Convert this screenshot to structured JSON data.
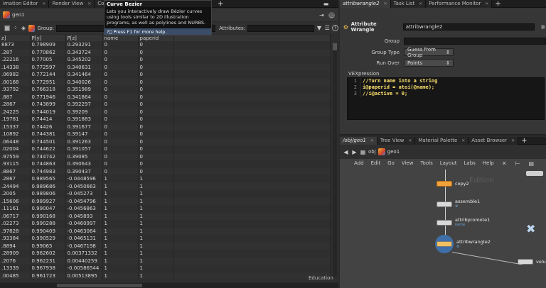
{
  "left_tabs": [
    {
      "label": "imation Editor"
    },
    {
      "label": "Render View"
    },
    {
      "label": "Composite Vi"
    }
  ],
  "right_tabs": [
    {
      "label": "attribwrangle2"
    },
    {
      "label": "Task List"
    },
    {
      "label": "Performance Monitor"
    }
  ],
  "path_left": "geo1",
  "path_right": {
    "obj": "obj",
    "geo": "geo1"
  },
  "filter": {
    "group_label": "Group:",
    "attributes_label": "Attributes:"
  },
  "tooltip": {
    "title": "Curve Bezier",
    "body": "Lets you interactively draw Bézier curves using tools similar to 2D illustration programs, as well as polylines and NURBS.",
    "help": "Press F1 for more help."
  },
  "spreadsheet": {
    "headers": [
      "z]",
      "P[y]",
      "P[z]",
      "name",
      "paperid"
    ],
    "rows": [
      [
        "8873",
        "0.798909",
        "0.293291",
        "0",
        "0"
      ],
      [
        ".287",
        "0.770862",
        "0.343724",
        "0",
        "0"
      ],
      [
        ".22216",
        "0.77005",
        "0.345202",
        "0",
        "0"
      ],
      [
        ".14338",
        "0.772597",
        "0.340631",
        "0",
        "0"
      ],
      [
        ".06982",
        "0.772144",
        "0.341464",
        "0",
        "0"
      ],
      [
        ".00168",
        "0.772951",
        "0.340026",
        "0",
        "0"
      ],
      [
        ".93792",
        "0.766318",
        "0.351989",
        "0",
        "0"
      ],
      [
        ".887",
        "0.771946",
        "0.341864",
        "0",
        "0"
      ],
      [
        ".2867",
        "0.743899",
        "0.392297",
        "0",
        "0"
      ],
      [
        ".24225",
        "0.744019",
        "0.39209",
        "0",
        "0"
      ],
      [
        ".19781",
        "0.74414",
        "0.391883",
        "0",
        "0"
      ],
      [
        ".15337",
        "0.74426",
        "0.391677",
        "0",
        "0"
      ],
      [
        ".10892",
        "0.744381",
        "0.39147",
        "0",
        "0"
      ],
      [
        ".06448",
        "0.744501",
        "0.391263",
        "0",
        "0"
      ],
      [
        ".02004",
        "0.744622",
        "0.391057",
        "0",
        "0"
      ],
      [
        ".97559",
        "0.744742",
        "0.39085",
        "0",
        "0"
      ],
      [
        ".93115",
        "0.744863",
        "0.390643",
        "0",
        "0"
      ],
      [
        ".8867",
        "0.744983",
        "0.390437",
        "0",
        "0"
      ],
      [
        ".2867",
        "0.989565",
        "-0.0448596",
        "1",
        "1"
      ],
      [
        ".24494",
        "0.989686",
        "-0.0450663",
        "1",
        "1"
      ],
      [
        ".2005",
        "0.989806",
        "-0.045273",
        "1",
        "1"
      ],
      [
        ".15606",
        "0.989927",
        "-0.0454796",
        "1",
        "1"
      ],
      [
        ".11161",
        "0.990047",
        "-0.0456863",
        "1",
        "1"
      ],
      [
        ".06717",
        "0.990168",
        "-0.045893",
        "1",
        "1"
      ],
      [
        ".02273",
        "0.990288",
        "-0.0460997",
        "1",
        "1"
      ],
      [
        ".97828",
        "0.990409",
        "-0.0463064",
        "1",
        "1"
      ],
      [
        ".93384",
        "0.990529",
        "-0.0465131",
        "1",
        "1"
      ],
      [
        ".8894",
        "0.99065",
        "-0.0467198",
        "1",
        "1"
      ],
      [
        ".28909",
        "0.962602",
        "0.00371332",
        "1",
        "1"
      ],
      [
        ".2076",
        "0.962231",
        "0.00440259",
        "1",
        "1"
      ],
      [
        ".13339",
        "0.967938",
        "-0.00586544",
        "1",
        "1"
      ],
      [
        ".00485",
        "0.961723",
        "0.00513895",
        "1",
        "1"
      ]
    ],
    "footer": "Education"
  },
  "wrangle": {
    "node_type": "Attribute Wrangle",
    "node_name": "attribwrangle2",
    "group_label": "Group",
    "group_type_label": "Group Type",
    "group_type_value": "Guess from Group",
    "run_over_label": "Run Over",
    "run_over_value": "Points",
    "vex_label": "VEXpression",
    "code": [
      {
        "n": "1",
        "text": "//Turn name into a string"
      },
      {
        "n": "2",
        "text": "i@paperid = atoi(@name);"
      },
      {
        "n": "3",
        "text": "//i@active = 0;"
      }
    ]
  },
  "network": {
    "path": "/obj/geo1",
    "tabs": [
      {
        "label": "Tree View"
      },
      {
        "label": "Material Palette"
      },
      {
        "label": "Asset Browser"
      }
    ],
    "menu": [
      "Add",
      "Edit",
      "Go",
      "View",
      "Tools",
      "Layout",
      "Labs",
      "Help"
    ],
    "watermark": "Edition",
    "nodes": [
      {
        "name": "copy2",
        "sub": ""
      },
      {
        "name": "assemble1",
        "sub": "⚙"
      },
      {
        "name": "attribpromote1",
        "sub": "name"
      },
      {
        "name": "attribwrangle2",
        "sub": "⚙"
      },
      {
        "name": "velu",
        "sub": ""
      }
    ]
  },
  "colors": {
    "accent": "#f2a23a",
    "blue": "#3b4c66",
    "node_blue": "#69a9e0"
  }
}
